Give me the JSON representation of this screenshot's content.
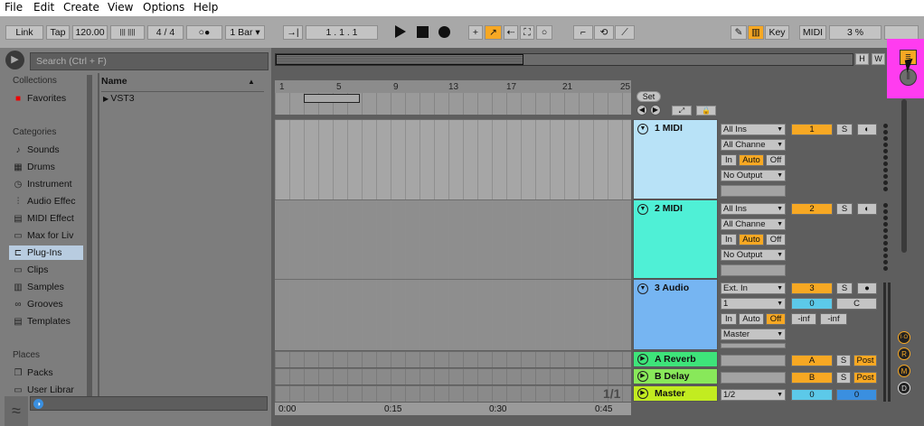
{
  "menu": [
    "File",
    "Edit",
    "Create",
    "View",
    "Options",
    "Help"
  ],
  "transport": {
    "link": "Link",
    "tap": "Tap",
    "tempo": "120.00",
    "time_sig": "4 / 4",
    "metronome": "○●",
    "quantize": "1 Bar",
    "position": "1 .   1 .   1",
    "key": "Key",
    "midi": "MIDI",
    "cpu": "3 %"
  },
  "browser": {
    "search_placeholder": "Search (Ctrl + F)",
    "collections_head": "Collections",
    "favorites": "Favorites",
    "categories_head": "Categories",
    "categories": [
      "Sounds",
      "Drums",
      "Instrument",
      "Audio Effec",
      "MIDI Effect",
      "Max for Liv",
      "Plug-Ins",
      "Clips",
      "Samples",
      "Grooves",
      "Templates"
    ],
    "places_head": "Places",
    "places": [
      "Packs",
      "User Librar"
    ],
    "name_col": "Name",
    "items": [
      "VST3"
    ]
  },
  "arrangement": {
    "ruler_top": [
      "1",
      "5",
      "9",
      "13",
      "17",
      "21",
      "25"
    ],
    "ruler_bottom": [
      "0:00",
      "0:15",
      "0:30",
      "0:45"
    ],
    "set_label": "Set",
    "page_indicator": "1/1",
    "overview_buttons": [
      "H",
      "W"
    ]
  },
  "tracks": [
    {
      "name": "1 MIDI",
      "color": "#b8e2f7",
      "input": "All Ins",
      "channel": "All Channe",
      "mon": [
        "In",
        "Auto",
        "Off"
      ],
      "output": "No Output",
      "num": "1",
      "solo": "S"
    },
    {
      "name": "2 MIDI",
      "color": "#4ff0d6",
      "input": "All Ins",
      "channel": "All Channe",
      "mon": [
        "In",
        "Auto",
        "Off"
      ],
      "output": "No Output",
      "num": "2",
      "solo": "S"
    },
    {
      "name": "3 Audio",
      "color": "#76b5f2",
      "input": "Ext. In",
      "channel": "1",
      "mon": [
        "In",
        "Auto",
        "Off"
      ],
      "output": "Master",
      "num": "3",
      "solo": "S",
      "vol": "0",
      "pan": "C",
      "meter_l": "-inf",
      "meter_r": "-inf"
    },
    {
      "name": "A Reverb",
      "color": "#3ee47a",
      "num": "A",
      "solo": "S",
      "post": "Post"
    },
    {
      "name": "B Delay",
      "color": "#88e85a",
      "num": "B",
      "solo": "S",
      "post": "Post"
    },
    {
      "name": "Master",
      "color": "#c2ec20",
      "channel": "1/2",
      "vol": "0",
      "pan": "0"
    }
  ],
  "side_buttons": [
    "I·O",
    "R",
    "M",
    "D"
  ],
  "colors": {
    "accent": "#f7a823",
    "highlight": "#ff3cf0"
  }
}
